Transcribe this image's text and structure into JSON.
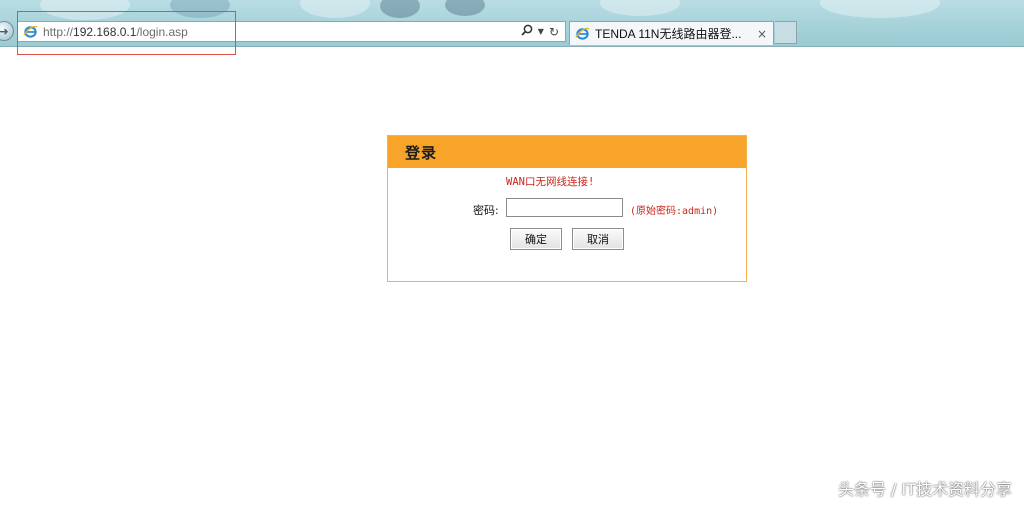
{
  "browser": {
    "address_prefix": "http://",
    "address_host": "192.168.0.1",
    "address_path": "/login.asp",
    "tab_title": "TENDA 11N无线路由器登...",
    "tab_close": "×"
  },
  "login": {
    "title": "登录",
    "warning": "WAN口无网线连接!",
    "password_label": "密码:",
    "password_value": "",
    "password_hint": "(原始密码:admin)",
    "ok_label": "确定",
    "cancel_label": "取消"
  },
  "watermark": "头条号 / IT技术资料分享",
  "colors": {
    "header_bg": "#f8a42a",
    "panel_border": "#f3b14d",
    "warning_text": "#c8261b",
    "highlight_box": "#e0504a"
  },
  "icons": [
    "back-arrow-icon",
    "ie-logo-icon",
    "search-icon",
    "dropdown-arrow-icon",
    "refresh-icon",
    "close-icon"
  ]
}
